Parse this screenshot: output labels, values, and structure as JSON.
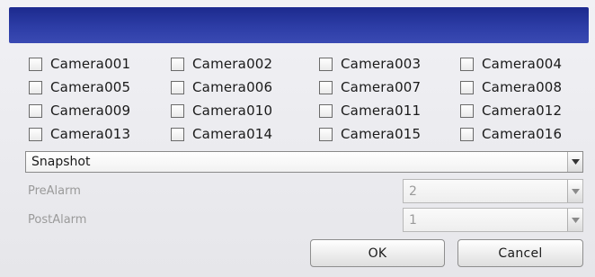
{
  "dialog": {
    "cameras": [
      {
        "label": "Camera001",
        "checked": false
      },
      {
        "label": "Camera002",
        "checked": false
      },
      {
        "label": "Camera003",
        "checked": false
      },
      {
        "label": "Camera004",
        "checked": false
      },
      {
        "label": "Camera005",
        "checked": false
      },
      {
        "label": "Camera006",
        "checked": false
      },
      {
        "label": "Camera007",
        "checked": false
      },
      {
        "label": "Camera008",
        "checked": false
      },
      {
        "label": "Camera009",
        "checked": false
      },
      {
        "label": "Camera010",
        "checked": false
      },
      {
        "label": "Camera011",
        "checked": false
      },
      {
        "label": "Camera012",
        "checked": false
      },
      {
        "label": "Camera013",
        "checked": false
      },
      {
        "label": "Camera014",
        "checked": false
      },
      {
        "label": "Camera015",
        "checked": false
      },
      {
        "label": "Camera016",
        "checked": false
      }
    ],
    "action_select": {
      "value": "Snapshot"
    },
    "prealarm": {
      "label": "PreAlarm",
      "value": "2"
    },
    "postalarm": {
      "label": "PostAlarm",
      "value": "1"
    },
    "ok_label": "OK",
    "cancel_label": "Cancel",
    "colors": {
      "titlebar": "#2a3aa2",
      "background": "#ececf0"
    },
    "icons": {
      "dropdown": "chevron-down-icon",
      "checkbox": "checkbox-unchecked-icon"
    }
  }
}
